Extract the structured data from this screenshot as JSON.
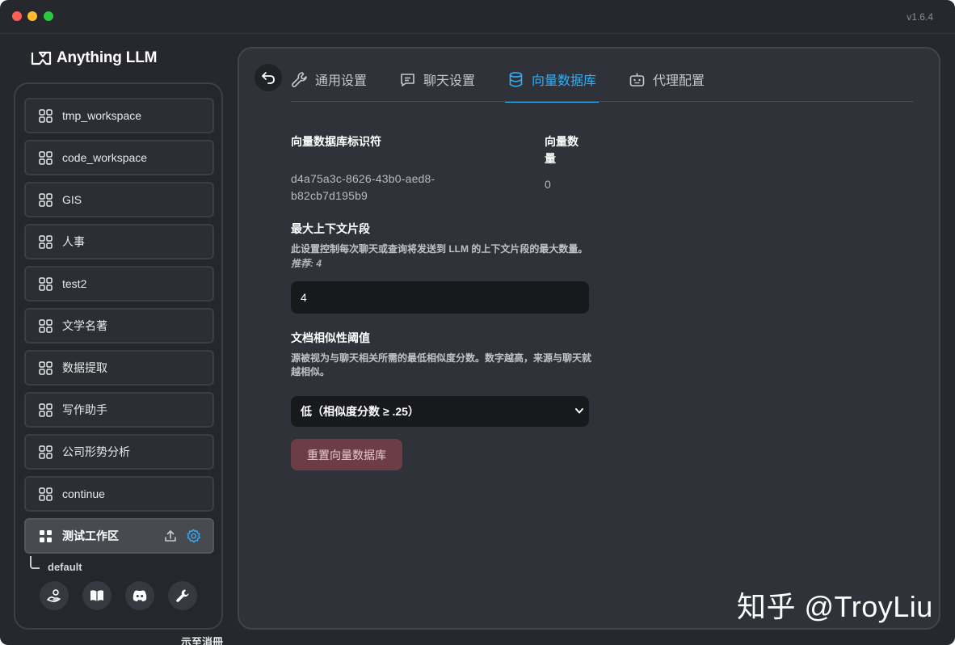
{
  "window": {
    "version": "v1.6.4"
  },
  "app": {
    "logo_text": "Anything LLM"
  },
  "sidebar": {
    "workspaces": [
      {
        "label": "tmp_workspace"
      },
      {
        "label": "code_workspace"
      },
      {
        "label": "GIS"
      },
      {
        "label": "人事"
      },
      {
        "label": "test2"
      },
      {
        "label": "文学名著"
      },
      {
        "label": "数据提取"
      },
      {
        "label": "写作助手"
      },
      {
        "label": "公司形势分析"
      },
      {
        "label": "continue"
      },
      {
        "label": "测试工作区"
      }
    ],
    "active_index": 10,
    "thread_label": "default",
    "footer_icons": [
      "community-hub-icon",
      "docs-book-icon",
      "discord-icon",
      "wrench-icon"
    ],
    "below_text": "示至消冊"
  },
  "tabs": [
    {
      "label": "通用设置",
      "icon": "wrench-icon"
    },
    {
      "label": "聊天设置",
      "icon": "chat-icon"
    },
    {
      "label": "向量数据库",
      "icon": "database-icon"
    },
    {
      "label": "代理配置",
      "icon": "robot-icon"
    }
  ],
  "active_tab": 2,
  "vector_db": {
    "identifier_title": "向量数据库标识符",
    "identifier_value": "d4a75a3c-8626-43b0-aed8-b82cb7d195b9",
    "count_title": "向量数量",
    "count_value": "0"
  },
  "max_context": {
    "title": "最大上下文片段",
    "description": "此设置控制每次聊天或查询将发送到 LLM 的上下文片段的最大数量。",
    "recommended": "推荐: 4",
    "value": "4"
  },
  "similarity": {
    "title": "文档相似性阈值",
    "description": "源被视为与聊天相关所需的最低相似度分数。数字越高，来源与聊天就越相似。",
    "selected": "低（相似度分数 ≥ .25）"
  },
  "reset_button": "重置向量数据库",
  "watermark": "知乎 @TroyLiu",
  "colors": {
    "accent": "#36aef4",
    "danger": "#6d3d45"
  }
}
